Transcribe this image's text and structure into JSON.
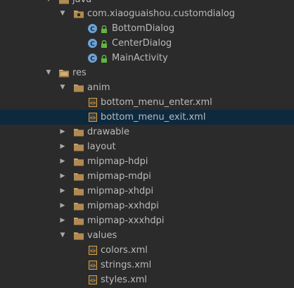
{
  "tree": {
    "java_folder": "java",
    "package": "com.xiaoguaishou.customdialog",
    "classes": [
      "BottomDialog",
      "CenterDialog",
      "MainActivity"
    ],
    "res_folder": "res",
    "anim_folder": "anim",
    "anim_files": [
      "bottom_menu_enter.xml",
      "bottom_menu_exit.xml"
    ],
    "folders": [
      "drawable",
      "layout",
      "mipmap-hdpi",
      "mipmap-mdpi",
      "mipmap-xhdpi",
      "mipmap-xxhdpi",
      "mipmap-xxxhdpi"
    ],
    "values_folder": "values",
    "values_files": [
      "colors.xml",
      "strings.xml",
      "styles.xml"
    ],
    "selected_item": "bottom_menu_exit.xml"
  },
  "colors": {
    "background": "#2b2b2b",
    "selection": "#0d293e",
    "text": "#bbbbbb",
    "folder": "#c7a36d",
    "class_icon": "#6da3d6",
    "xml_icon": "#e0a040"
  },
  "icons": {
    "expanded": "triangle-down",
    "collapsed": "triangle-right",
    "folder": "folder-icon",
    "package": "package-icon",
    "class": "class-icon",
    "xml": "xml-file-icon",
    "lock": "lock-icon"
  }
}
